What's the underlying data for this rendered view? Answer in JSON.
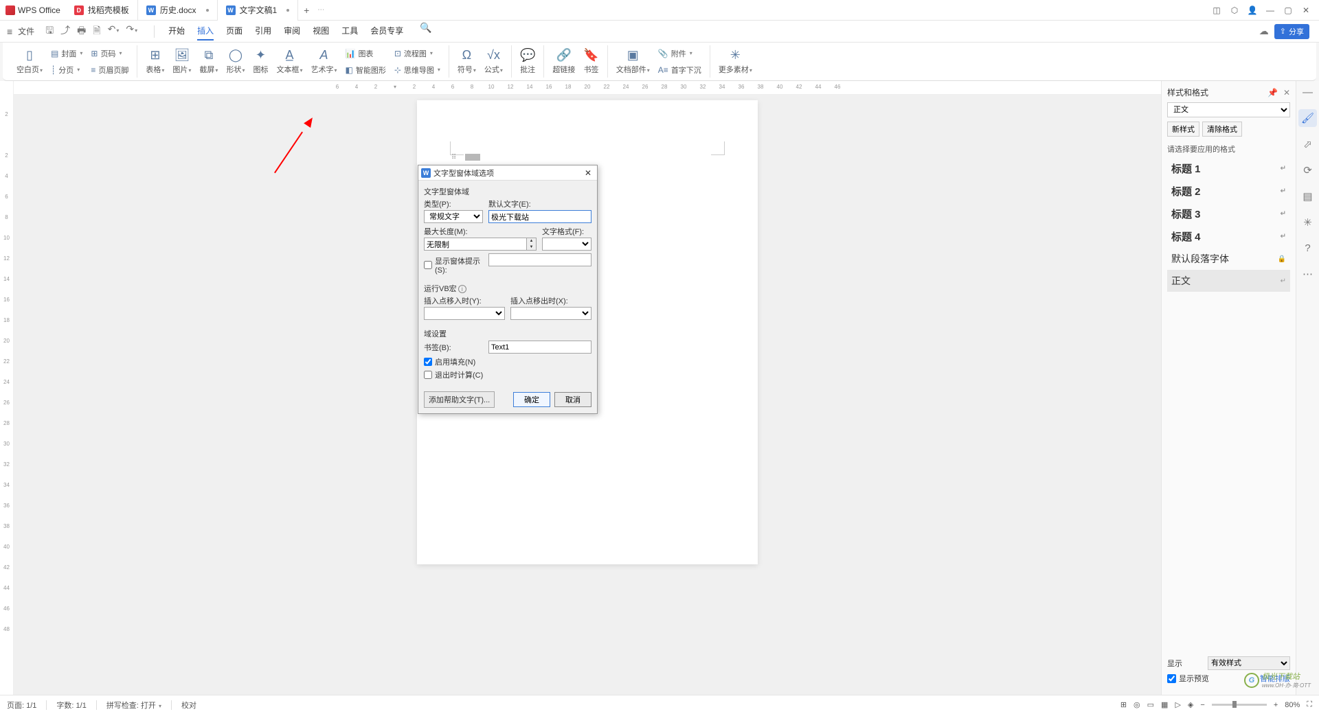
{
  "titlebar": {
    "app": "WPS Office",
    "tabs": [
      {
        "label": "找稻壳模板",
        "icon": "d"
      },
      {
        "label": "历史.docx",
        "icon": "w"
      },
      {
        "label": "文字文稿1",
        "icon": "w",
        "active": true
      }
    ]
  },
  "menubar": {
    "file": "文件",
    "tabs": [
      "开始",
      "插入",
      "页面",
      "引用",
      "审阅",
      "视图",
      "工具",
      "会员专享"
    ],
    "active": "插入",
    "share": "分享"
  },
  "ribbon": {
    "blank": "空白页",
    "cover": "封面",
    "section": "分页",
    "pagenum": "页码",
    "header": "页眉页脚",
    "table": "表格",
    "picture": "图片",
    "screenshot": "截屏",
    "shape": "形状",
    "icon": "图标",
    "textbox": "文本框",
    "wordart": "艺术字",
    "chart": "图表",
    "flowchart": "流程图",
    "smartart": "智能图形",
    "mindmap": "思维导图",
    "symbol": "符号",
    "equation": "公式",
    "comment": "批注",
    "hyperlink": "超链接",
    "bookmark": "书签",
    "docpart": "文档部件",
    "attachment": "附件",
    "dropcap": "首字下沉",
    "more": "更多素材"
  },
  "ruler_h": [
    "6",
    "4",
    "2",
    "",
    "2",
    "4",
    "6",
    "8",
    "10",
    "12",
    "14",
    "16",
    "18",
    "20",
    "22",
    "24",
    "26",
    "28",
    "30",
    "32",
    "34",
    "36",
    "38",
    "40",
    "42",
    "44",
    "46"
  ],
  "ruler_v": [
    "",
    "2",
    "",
    "2",
    "4",
    "6",
    "8",
    "10",
    "12",
    "14",
    "16",
    "18",
    "20",
    "22",
    "24",
    "26",
    "28",
    "30",
    "32",
    "34",
    "36",
    "38",
    "40",
    "42",
    "44",
    "46",
    "48"
  ],
  "dialog": {
    "title": "文字型窗体域选项",
    "fs1": "文字型窗体域",
    "type_lbl": "类型(P):",
    "type_val": "常规文字",
    "default_lbl": "默认文字(E):",
    "default_val": "极光下载站",
    "maxlen_lbl": "最大长度(M):",
    "maxlen_val": "无限制",
    "format_lbl": "文字格式(F):",
    "format_val": "",
    "tooltip_chk": "显示窗体提示(S):",
    "fs2": "运行VB宏",
    "enter_lbl": "插入点移入时(Y):",
    "exit_lbl": "插入点移出时(X):",
    "fs3": "域设置",
    "bookmark_lbl": "书签(B):",
    "bookmark_val": "Text1",
    "fill_chk": "启用填充(N)",
    "calc_chk": "退出时计算(C)",
    "help_btn": "添加帮助文字(T)...",
    "ok": "确定",
    "cancel": "取消"
  },
  "sidepanel": {
    "title": "样式和格式",
    "current_style": "正文",
    "new_style": "新样式",
    "clear_fmt": "清除格式",
    "pick_label": "请选择要应用的格式",
    "styles": [
      {
        "label": "标题 1",
        "big": true
      },
      {
        "label": "标题 2",
        "big": true
      },
      {
        "label": "标题 3",
        "big": true
      },
      {
        "label": "标题 4",
        "big": true
      },
      {
        "label": "默认段落字体",
        "big": false,
        "lock": true
      },
      {
        "label": "正文",
        "big": false,
        "sel": true
      }
    ],
    "show_lbl": "显示",
    "show_val": "有效样式",
    "preview_chk": "显示预览",
    "smart": "智能排版"
  },
  "statusbar": {
    "page": "页面: 1/1",
    "words": "字数: 1/1",
    "spell": "拼写检查: 打开",
    "proof": "校对",
    "zoom": "80%"
  },
  "watermark": {
    "main": "极光下载站",
    "sub": "www.OH·办·简·OTT"
  }
}
